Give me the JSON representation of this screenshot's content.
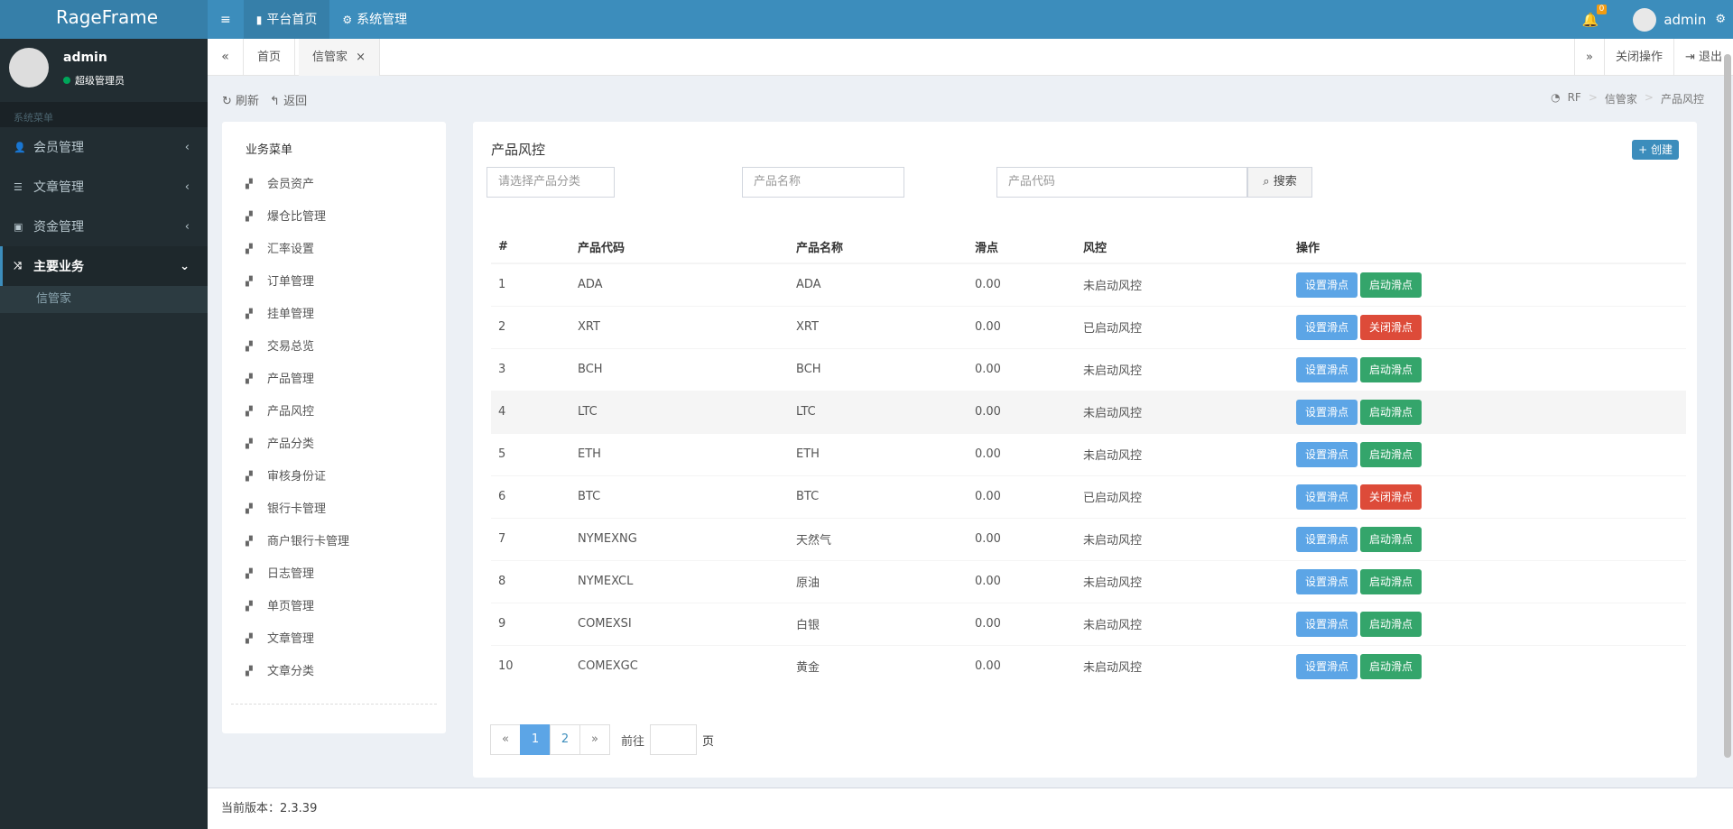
{
  "app": {
    "logo": "RageFrame"
  },
  "topnav": [
    {
      "icon": "bookmark-icon",
      "glyph": "▮",
      "label": "平台首页",
      "active": true
    },
    {
      "icon": "gears-icon",
      "glyph": "⚙",
      "label": "系统管理",
      "active": false
    }
  ],
  "topright": {
    "notifications": "0",
    "username": "admin"
  },
  "user": {
    "name": "admin",
    "role": "超级管理员"
  },
  "sidebar": {
    "header": "系统菜单",
    "items": [
      {
        "label": "会员管理",
        "icon": "user-icon",
        "glyph": "👤"
      },
      {
        "label": "文章管理",
        "icon": "list-icon",
        "glyph": "☰"
      },
      {
        "label": "资金管理",
        "icon": "money-icon",
        "glyph": "▣"
      }
    ],
    "active": {
      "label": "主要业务",
      "icon": "random-icon",
      "glyph": "⤨"
    },
    "sub": "信管家"
  },
  "tabs": {
    "home": "首页",
    "current": "信管家",
    "close_op": "关闭操作",
    "logout": "退出"
  },
  "toolbar": {
    "refresh": "刷新",
    "back": "返回"
  },
  "breadcrumb": [
    "RF",
    "信管家",
    "产品风控"
  ],
  "left_menu": {
    "title": "业务菜单",
    "items": [
      "会员资产",
      "爆仓比管理",
      "汇率设置",
      "订单管理",
      "挂单管理",
      "交易总览",
      "产品管理",
      "产品风控",
      "产品分类",
      "审核身份证",
      "银行卡管理",
      "商户银行卡管理",
      "日志管理",
      "单页管理",
      "文章管理",
      "文章分类"
    ]
  },
  "main": {
    "title": "产品风控",
    "create": "创建",
    "filter": {
      "category_placeholder": "请选择产品分类",
      "name_placeholder": "产品名称",
      "code_placeholder": "产品代码",
      "search": "搜索"
    },
    "columns": [
      "#",
      "产品代码",
      "产品名称",
      "滑点",
      "风控",
      "操作"
    ],
    "rows": [
      {
        "id": "1",
        "code": "ADA",
        "name": "ADA",
        "slip": "0.00",
        "risk": "未启动风控",
        "b1": "设置滑点",
        "b2": "启动滑点",
        "b2type": "success"
      },
      {
        "id": "2",
        "code": "XRT",
        "name": "XRT",
        "slip": "0.00",
        "risk": "已启动风控",
        "b1": "设置滑点",
        "b2": "关闭滑点",
        "b2type": "danger"
      },
      {
        "id": "3",
        "code": "BCH",
        "name": "BCH",
        "slip": "0.00",
        "risk": "未启动风控",
        "b1": "设置滑点",
        "b2": "启动滑点",
        "b2type": "success"
      },
      {
        "id": "4",
        "code": "LTC",
        "name": "LTC",
        "slip": "0.00",
        "risk": "未启动风控",
        "b1": "设置滑点",
        "b2": "启动滑点",
        "b2type": "success"
      },
      {
        "id": "5",
        "code": "ETH",
        "name": "ETH",
        "slip": "0.00",
        "risk": "未启动风控",
        "b1": "设置滑点",
        "b2": "启动滑点",
        "b2type": "success"
      },
      {
        "id": "6",
        "code": "BTC",
        "name": "BTC",
        "slip": "0.00",
        "risk": "已启动风控",
        "b1": "设置滑点",
        "b2": "关闭滑点",
        "b2type": "danger"
      },
      {
        "id": "7",
        "code": "NYMEXNG",
        "name": "天然气",
        "slip": "0.00",
        "risk": "未启动风控",
        "b1": "设置滑点",
        "b2": "启动滑点",
        "b2type": "success"
      },
      {
        "id": "8",
        "code": "NYMEXCL",
        "name": "原油",
        "slip": "0.00",
        "risk": "未启动风控",
        "b1": "设置滑点",
        "b2": "启动滑点",
        "b2type": "success"
      },
      {
        "id": "9",
        "code": "COMEXSI",
        "name": "白银",
        "slip": "0.00",
        "risk": "未启动风控",
        "b1": "设置滑点",
        "b2": "启动滑点",
        "b2type": "success"
      },
      {
        "id": "10",
        "code": "COMEXGC",
        "name": "黄金",
        "slip": "0.00",
        "risk": "未启动风控",
        "b1": "设置滑点",
        "b2": "启动滑点",
        "b2type": "success"
      }
    ],
    "pagination": {
      "prev": "«",
      "pages": [
        "1",
        "2"
      ],
      "current": "1",
      "next": "»",
      "goto": "前往",
      "page_unit": "页"
    }
  },
  "footer": {
    "version": "当前版本：2.3.39"
  }
}
